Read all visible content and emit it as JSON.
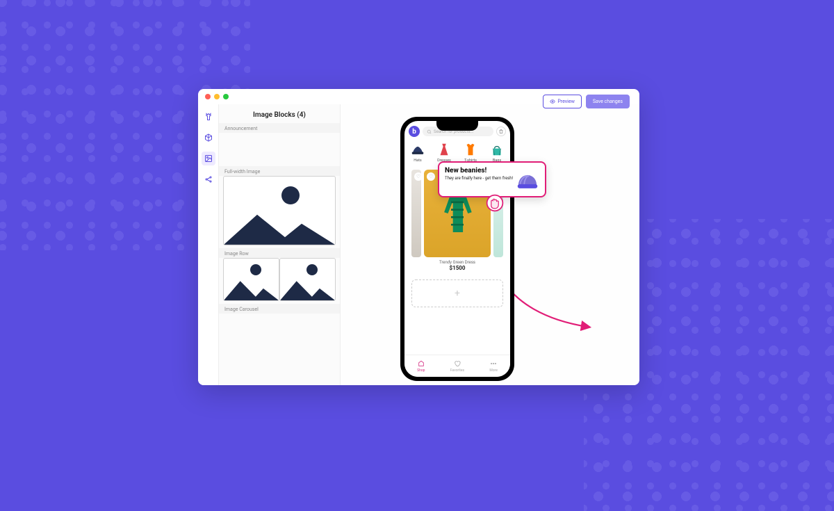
{
  "header": {
    "preview_label": "Preview",
    "save_label": "Save changes"
  },
  "blocks_panel": {
    "title": "Image Blocks (4)",
    "sections": {
      "announcement": "Announcement",
      "full_width": "Full-width Image",
      "image_row": "Image Row",
      "image_carousel": "Image Carousel"
    }
  },
  "float_banner": {
    "title": "New beanies!",
    "subtitle": "They are finally here - get them fresh!"
  },
  "phone": {
    "search_placeholder": "Search for products...",
    "categories": [
      {
        "label": "Hats",
        "color": "#2b3a67"
      },
      {
        "label": "Dresses",
        "color": "#e0414b"
      },
      {
        "label": "T-shirts",
        "color": "#ff7a00"
      },
      {
        "label": "Bags",
        "color": "#2fb8a6"
      }
    ],
    "hero_product": {
      "name": "Trendy Green Dress",
      "price": "$1500"
    },
    "tabbar": {
      "shop": "Shop",
      "favorites": "Favorites",
      "more": "More"
    }
  }
}
